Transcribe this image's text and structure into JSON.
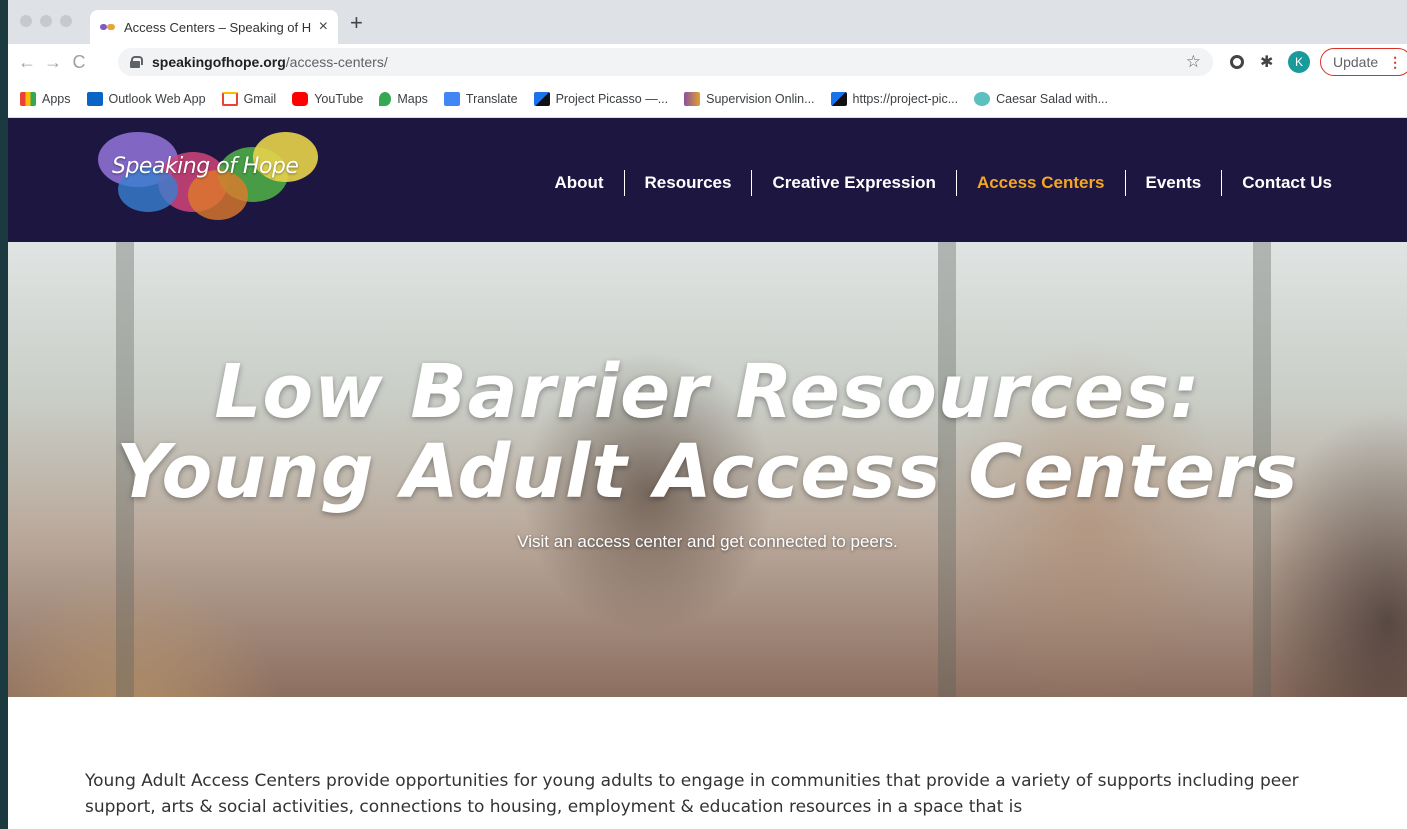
{
  "browser": {
    "tab_title": "Access Centers – Speaking of H",
    "tab_close": "×",
    "new_tab": "+",
    "url_domain": "speakingofhope.org",
    "url_path": "/access-centers/",
    "profile_initial": "K",
    "update_label": "Update",
    "update_menu": "⋮",
    "back": "←",
    "forward": "→",
    "reload": "C",
    "star": "☆"
  },
  "bookmarks": [
    {
      "label": "Apps",
      "icon": "apps-grid-icon",
      "color": "#ea4335"
    },
    {
      "label": "Outlook Web App",
      "icon": "outlook-icon",
      "color": "#0a64c6"
    },
    {
      "label": "Gmail",
      "icon": "gmail-icon",
      "color": "#ea4335"
    },
    {
      "label": "YouTube",
      "icon": "youtube-icon",
      "color": "#ff0000"
    },
    {
      "label": "Maps",
      "icon": "maps-pin-icon",
      "color": "#34a853"
    },
    {
      "label": "Translate",
      "icon": "translate-icon",
      "color": "#4285f4"
    },
    {
      "label": "Project Picasso —...",
      "icon": "picasso-icon",
      "color": "#1a73e8"
    },
    {
      "label": "Supervision Onlin...",
      "icon": "supervision-icon",
      "color": "#8a4fa0"
    },
    {
      "label": "https://project-pic...",
      "icon": "picasso-icon",
      "color": "#1a73e8"
    },
    {
      "label": "Caesar Salad with...",
      "icon": "salad-icon",
      "color": "#5bc0be"
    }
  ],
  "site": {
    "logo_text": "Speaking of Hope",
    "nav": [
      {
        "label": "About",
        "active": false
      },
      {
        "label": "Resources",
        "active": false
      },
      {
        "label": "Creative Expression",
        "active": false
      },
      {
        "label": "Access Centers",
        "active": true
      },
      {
        "label": "Events",
        "active": false
      },
      {
        "label": "Contact Us",
        "active": false
      }
    ],
    "accent_color": "#f5a623",
    "header_color": "#1c1640"
  },
  "hero": {
    "title_line1": "Low Barrier Resources:",
    "title_line2": "Young Adult Access Centers",
    "subtitle": "Visit an access center and get connected to peers."
  },
  "content": {
    "paragraph": "Young Adult Access Centers provide opportunities for young adults to engage in communities that provide a variety of supports including peer support, arts & social activities, connections to housing, employment & education resources in a space that is"
  }
}
